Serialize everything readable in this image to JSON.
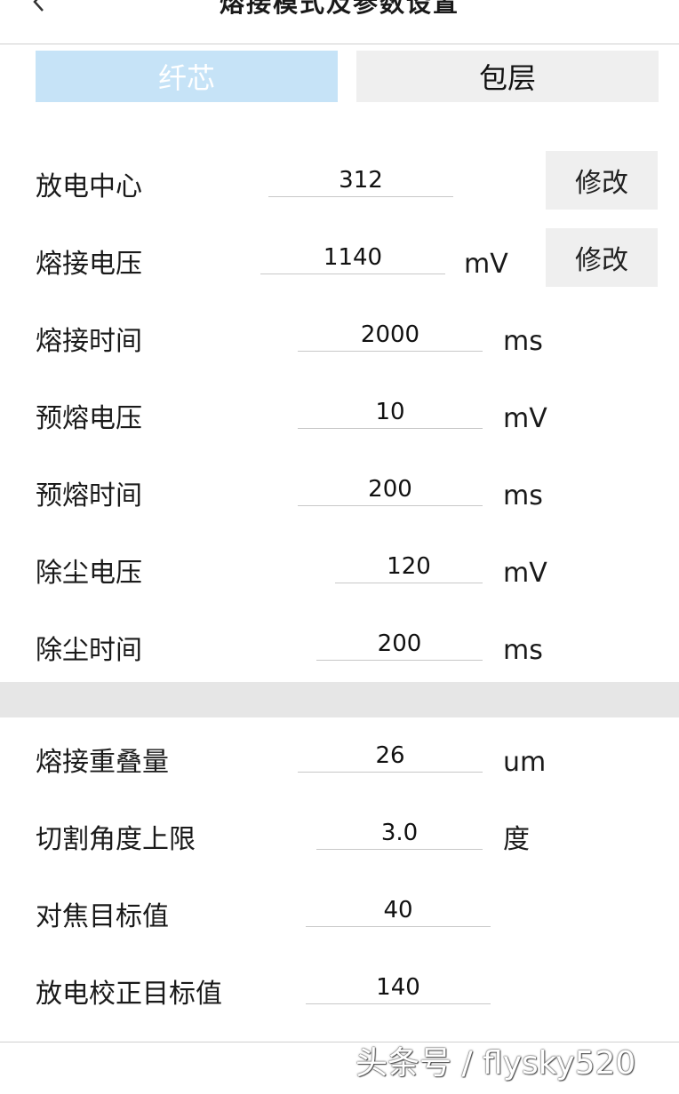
{
  "header": {
    "title": "熔接模式及参数设置",
    "back_icon": "chevron-left-icon"
  },
  "tabs": [
    {
      "label": "纤芯",
      "active": true
    },
    {
      "label": "包层",
      "active": false
    }
  ],
  "params": [
    {
      "label": "放电中心",
      "value": "312",
      "unit": "",
      "button": "修改"
    },
    {
      "label": "熔接电压",
      "value": "1140",
      "unit": "mV",
      "button": "修改"
    },
    {
      "label": "熔接时间",
      "value": "2000",
      "unit": "ms"
    },
    {
      "label": "预熔电压",
      "value": "10",
      "unit": "mV"
    },
    {
      "label": "预熔时间",
      "value": "200",
      "unit": "ms"
    },
    {
      "label": "除尘电压",
      "value": "120",
      "unit": "mV"
    },
    {
      "label": "除尘时间",
      "value": "200",
      "unit": "ms"
    },
    {
      "label": "熔接重叠量",
      "value": "26",
      "unit": "um"
    },
    {
      "label": "切割角度上限",
      "value": "3.0",
      "unit": "度"
    },
    {
      "label": "对焦目标值",
      "value": "40",
      "unit": ""
    },
    {
      "label": "放电校正目标值",
      "value": "140",
      "unit": ""
    }
  ],
  "watermark": "头条号 / flysky520",
  "colors": {
    "active_tab": "#c6e3f7",
    "inactive_tab": "#efefef",
    "divider": "#e6e6e6"
  }
}
